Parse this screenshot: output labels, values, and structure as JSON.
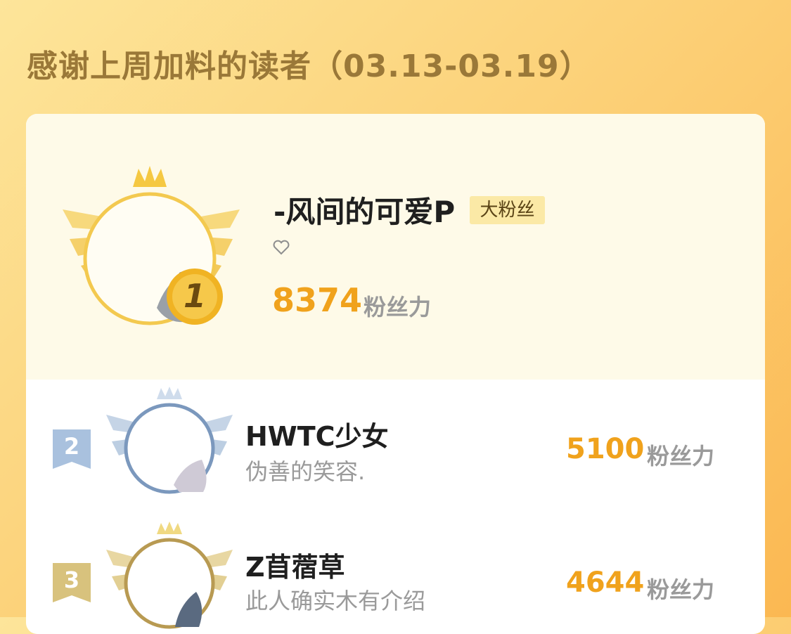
{
  "header": {
    "title": "感谢上周加料的读者（03.13-03.19）"
  },
  "leaderboard": {
    "first": {
      "rank": "1",
      "name": "-风间的可爱P",
      "badge": "大粉丝",
      "signature_icon": "heart-outline-icon",
      "score": "8374",
      "unit": "粉丝力"
    },
    "others": [
      {
        "rank": "2",
        "name": "HWTC少女",
        "signature": "伪善的笑容.",
        "score": "5100",
        "unit": "粉丝力"
      },
      {
        "rank": "3",
        "name": "Z苜蓿草",
        "signature": "此人确实木有介绍",
        "score": "4644",
        "unit": "粉丝力"
      }
    ]
  },
  "colors": {
    "gold": "#f0a21c",
    "silver": "#7b98bd",
    "bronze": "#b89a52",
    "title": "#9a7838"
  }
}
